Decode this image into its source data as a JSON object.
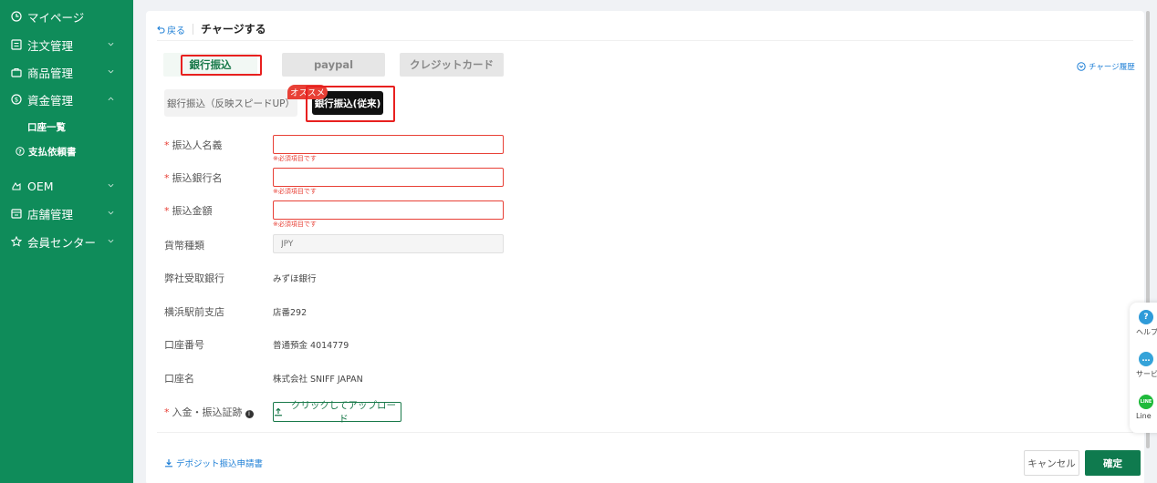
{
  "sidebar": {
    "items": [
      {
        "label": "マイページ",
        "icon": "clock-icon"
      },
      {
        "label": "注文管理",
        "icon": "order-list-icon"
      },
      {
        "label": "商品管理",
        "icon": "bag-icon"
      },
      {
        "label": "資金管理",
        "icon": "money-icon"
      },
      {
        "label": "OEM",
        "icon": "oem-icon"
      },
      {
        "label": "店舗管理",
        "icon": "store-icon"
      },
      {
        "label": "会員センター",
        "icon": "star-icon"
      }
    ],
    "subitems": [
      {
        "label": "口座一覧"
      },
      {
        "label": "支払依頼書",
        "icon": "question-circle-icon"
      }
    ],
    "bg_color": "#0f8c5a"
  },
  "header": {
    "back_label": "戻る",
    "title": "チャージする"
  },
  "methods": {
    "tabs": [
      "銀行振込",
      "paypal",
      "クレジットカード"
    ],
    "active": "銀行振込",
    "history_label": "チャージ履歴"
  },
  "subtabs": {
    "items": [
      "銀行振込（反映スピードUP）",
      "銀行振込(従来)"
    ],
    "badge": "オススメ",
    "active": "銀行振込(従来)"
  },
  "form": {
    "payer_name": {
      "label": "振込人名義",
      "value": "",
      "error": "※必須項目です"
    },
    "bank_name": {
      "label": "振込銀行名",
      "value": "",
      "error": "※必須項目です"
    },
    "amount": {
      "label": "振込金額",
      "value": "",
      "error": "※必須項目です"
    },
    "currency": {
      "label": "貨幣種類",
      "placeholder": "JPY"
    },
    "receiving_bank": {
      "label": "弊社受取銀行",
      "value": "みずほ銀行"
    },
    "branch": {
      "label": "横浜駅前支店",
      "value": "店番292"
    },
    "account_number": {
      "label": "口座番号",
      "value": "普通預金 4014779"
    },
    "account_name": {
      "label": "口座名",
      "value": "株式会社 SNIFF JAPAN"
    },
    "proof": {
      "label": "入金・振込証跡",
      "info": "i",
      "upload_label": "クリックしてアップロード"
    }
  },
  "footer": {
    "deposit_link": "デポジット振込申請書",
    "cancel_label": "キャンセル",
    "confirm_label": "確定"
  },
  "float_panel": {
    "items": [
      {
        "label": "ヘルプ",
        "glyph": "?",
        "color": "#2f9bd9"
      },
      {
        "label": "サービス",
        "glyph": "…",
        "color": "#35a3d9"
      },
      {
        "label": "Line",
        "glyph": "LINE",
        "color": "#1fba3b"
      }
    ]
  },
  "colors": {
    "accent_green": "#0f7a4e",
    "link_blue": "#1e7fd6",
    "error_red": "#e84036",
    "highlight_red": "#e8201f"
  }
}
